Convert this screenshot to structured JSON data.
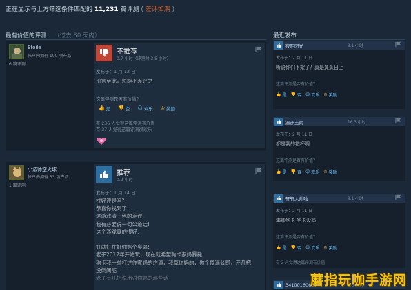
{
  "header": {
    "prefix": "正在显示与上方筛选条件匹配的",
    "count": "11,231",
    "suffix": "篇评测",
    "paren_open": "(",
    "rating": "差评如潮",
    "paren_close": ")"
  },
  "left_section": {
    "title": "最有价值的评测",
    "subtitle": "（过去 30 天内）"
  },
  "right_section": {
    "title": "最近发布"
  },
  "reviews": [
    {
      "author": "Etoile",
      "products": "帐户内拥有 100 项产品",
      "review_count": "6 篇评测",
      "verdict": "不推荐",
      "hours": "0.7 小时（评测时 3.5 小时）",
      "posted": "发布于：1 月 12 日",
      "body": [
        "引言至此，怎能不差评之"
      ],
      "helpful_q": "这篇评测是否有价值？",
      "buttons": {
        "yes": "是",
        "no": "否",
        "funny": "欢乐",
        "award": "奖励"
      },
      "stats": [
        "有 236 人觉得这篇评测有价值",
        "有 37 人觉得这篇评测很欢乐"
      ]
    },
    {
      "author": "小法师逆火球",
      "products": "帐户内拥有 33 项产品",
      "review_count": "1 篇评测",
      "verdict": "推荐",
      "hours": "0.2 小时",
      "posted": "发布于：1 月 14 日",
      "body": [
        "找好评是吗?",
        "恭喜你找到了!",
        "这游戏清一色的差评,",
        "我有必要说一句公道话!",
        "这个游戏真的很好,",
        "",
        "好就好在好你妈个臭逼!",
        "老子2012年开始玩，现在就希望狗卡家妈暴毙",
        "狗卡我一拳打烂你家妈的烂逼，我草你妈的，你个傻逼公司，还几把",
        "没倒闭呢",
        "老子有几把说出对你妈的那些话"
      ]
    }
  ],
  "recent": [
    {
      "name": "夜阴阳光",
      "hours": "9.1 小时",
      "posted": "发布于：2 月 11 日",
      "text": "听说你们下架了？真是蒸蒸日上",
      "q": "这篇评测是否有价值？",
      "buttons": {
        "yes": "是",
        "no": "否",
        "funny": "欢乐",
        "award": "奖励"
      }
    },
    {
      "name": "瀛洲玉雨",
      "hours": "16.3 小时",
      "posted": "发布于：2 月 11 日",
      "text": "都是我的错杯啊",
      "q": "这篇评测是否有价值？",
      "buttons": {
        "yes": "是",
        "no": "否",
        "funny": "欢乐",
        "award": "奖励"
      }
    },
    {
      "name": "轩轩太帅啦",
      "hours": "9.1 小时",
      "posted": "发布于：2 月 11 日",
      "text": "骗钱狗卡 狗卡没妈",
      "q": "这篇评测是否有价值？",
      "buttons": {
        "yes": "是",
        "no": "否",
        "funny": "欢乐",
        "award": "奖励"
      },
      "stat": "有 2 人觉得这篇评测有价值"
    },
    {
      "name": "3410016069",
      "hours": "1.6 小时"
    }
  ],
  "watermark": "蘑指玩咖手游网",
  "colors": {
    "background": "#1b2838",
    "negative": "#c04738",
    "positive": "#2b6ea1",
    "link": "#67c1f5",
    "rating_text": "#c35c2c"
  },
  "icons": [
    "thumbs-down-icon",
    "thumbs-up-icon",
    "smile-icon",
    "award-icon",
    "flag-icon",
    "avatar-icon"
  ]
}
